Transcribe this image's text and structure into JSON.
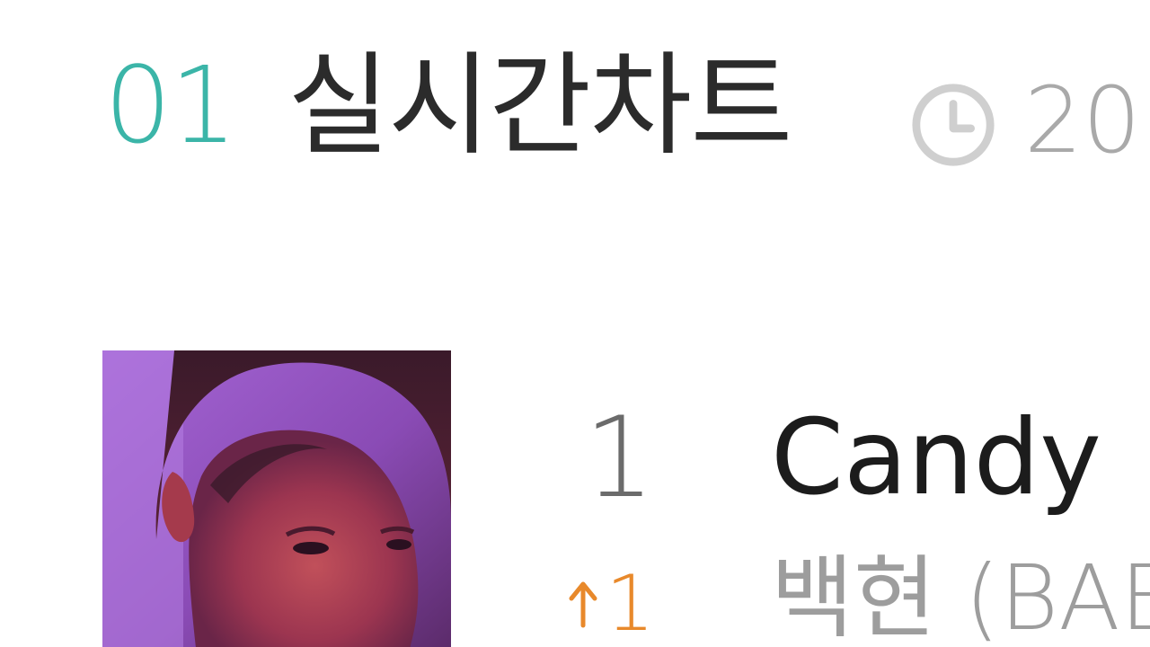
{
  "header": {
    "section_number": "01",
    "section_title": "실시간차트",
    "updated_time": "20",
    "clock_icon": "clock-icon"
  },
  "chart_list": {
    "items": [
      {
        "rank": "1",
        "rank_change": "1",
        "rank_change_direction": "up",
        "title": "Candy",
        "artist": "백현 (BAE",
        "album_art_icon": "album-cover-image"
      }
    ]
  },
  "colors": {
    "accent_teal": "#3bb5a8",
    "rank_up_orange": "#e8892b",
    "title_dark": "#2b2b2b",
    "muted_gray": "#9d9d9d"
  }
}
